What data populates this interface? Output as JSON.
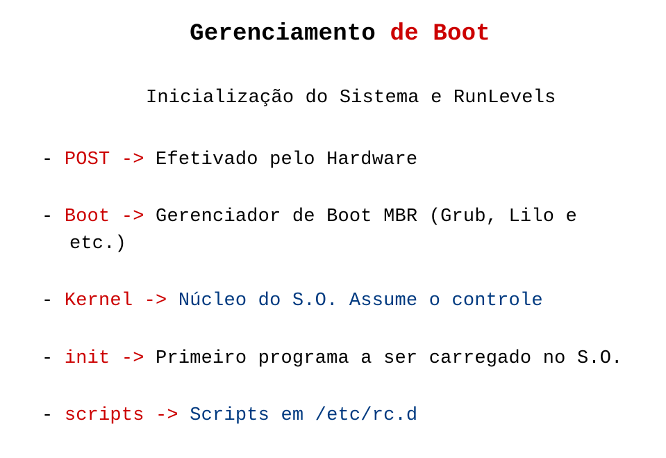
{
  "title": {
    "part1": "Gerenciamento ",
    "part2": "de Boot"
  },
  "subtitle": "Inicialização do Sistema e RunLevels",
  "lines": {
    "l1_dash": "- ",
    "l1_a": "POST -> ",
    "l1_b": "Efetivado pelo Hardware",
    "l2_dash": "- ",
    "l2_a": "Boot -> ",
    "l2_b": "Gerenciador de Boot MBR (Grub, Lilo e",
    "l2_cont": "etc.)",
    "l3_dash": "- ",
    "l3_a": "Kernel -> ",
    "l3_b": "Núcleo do S.O. Assume o controle",
    "l4_dash": "- ",
    "l4_a": "init -> ",
    "l4_b": "Primeiro programa a ser carregado no S.O.",
    "l5_dash": "- ",
    "l5_a": "scripts -> ",
    "l5_b": "Scripts em /etc/rc.d"
  }
}
